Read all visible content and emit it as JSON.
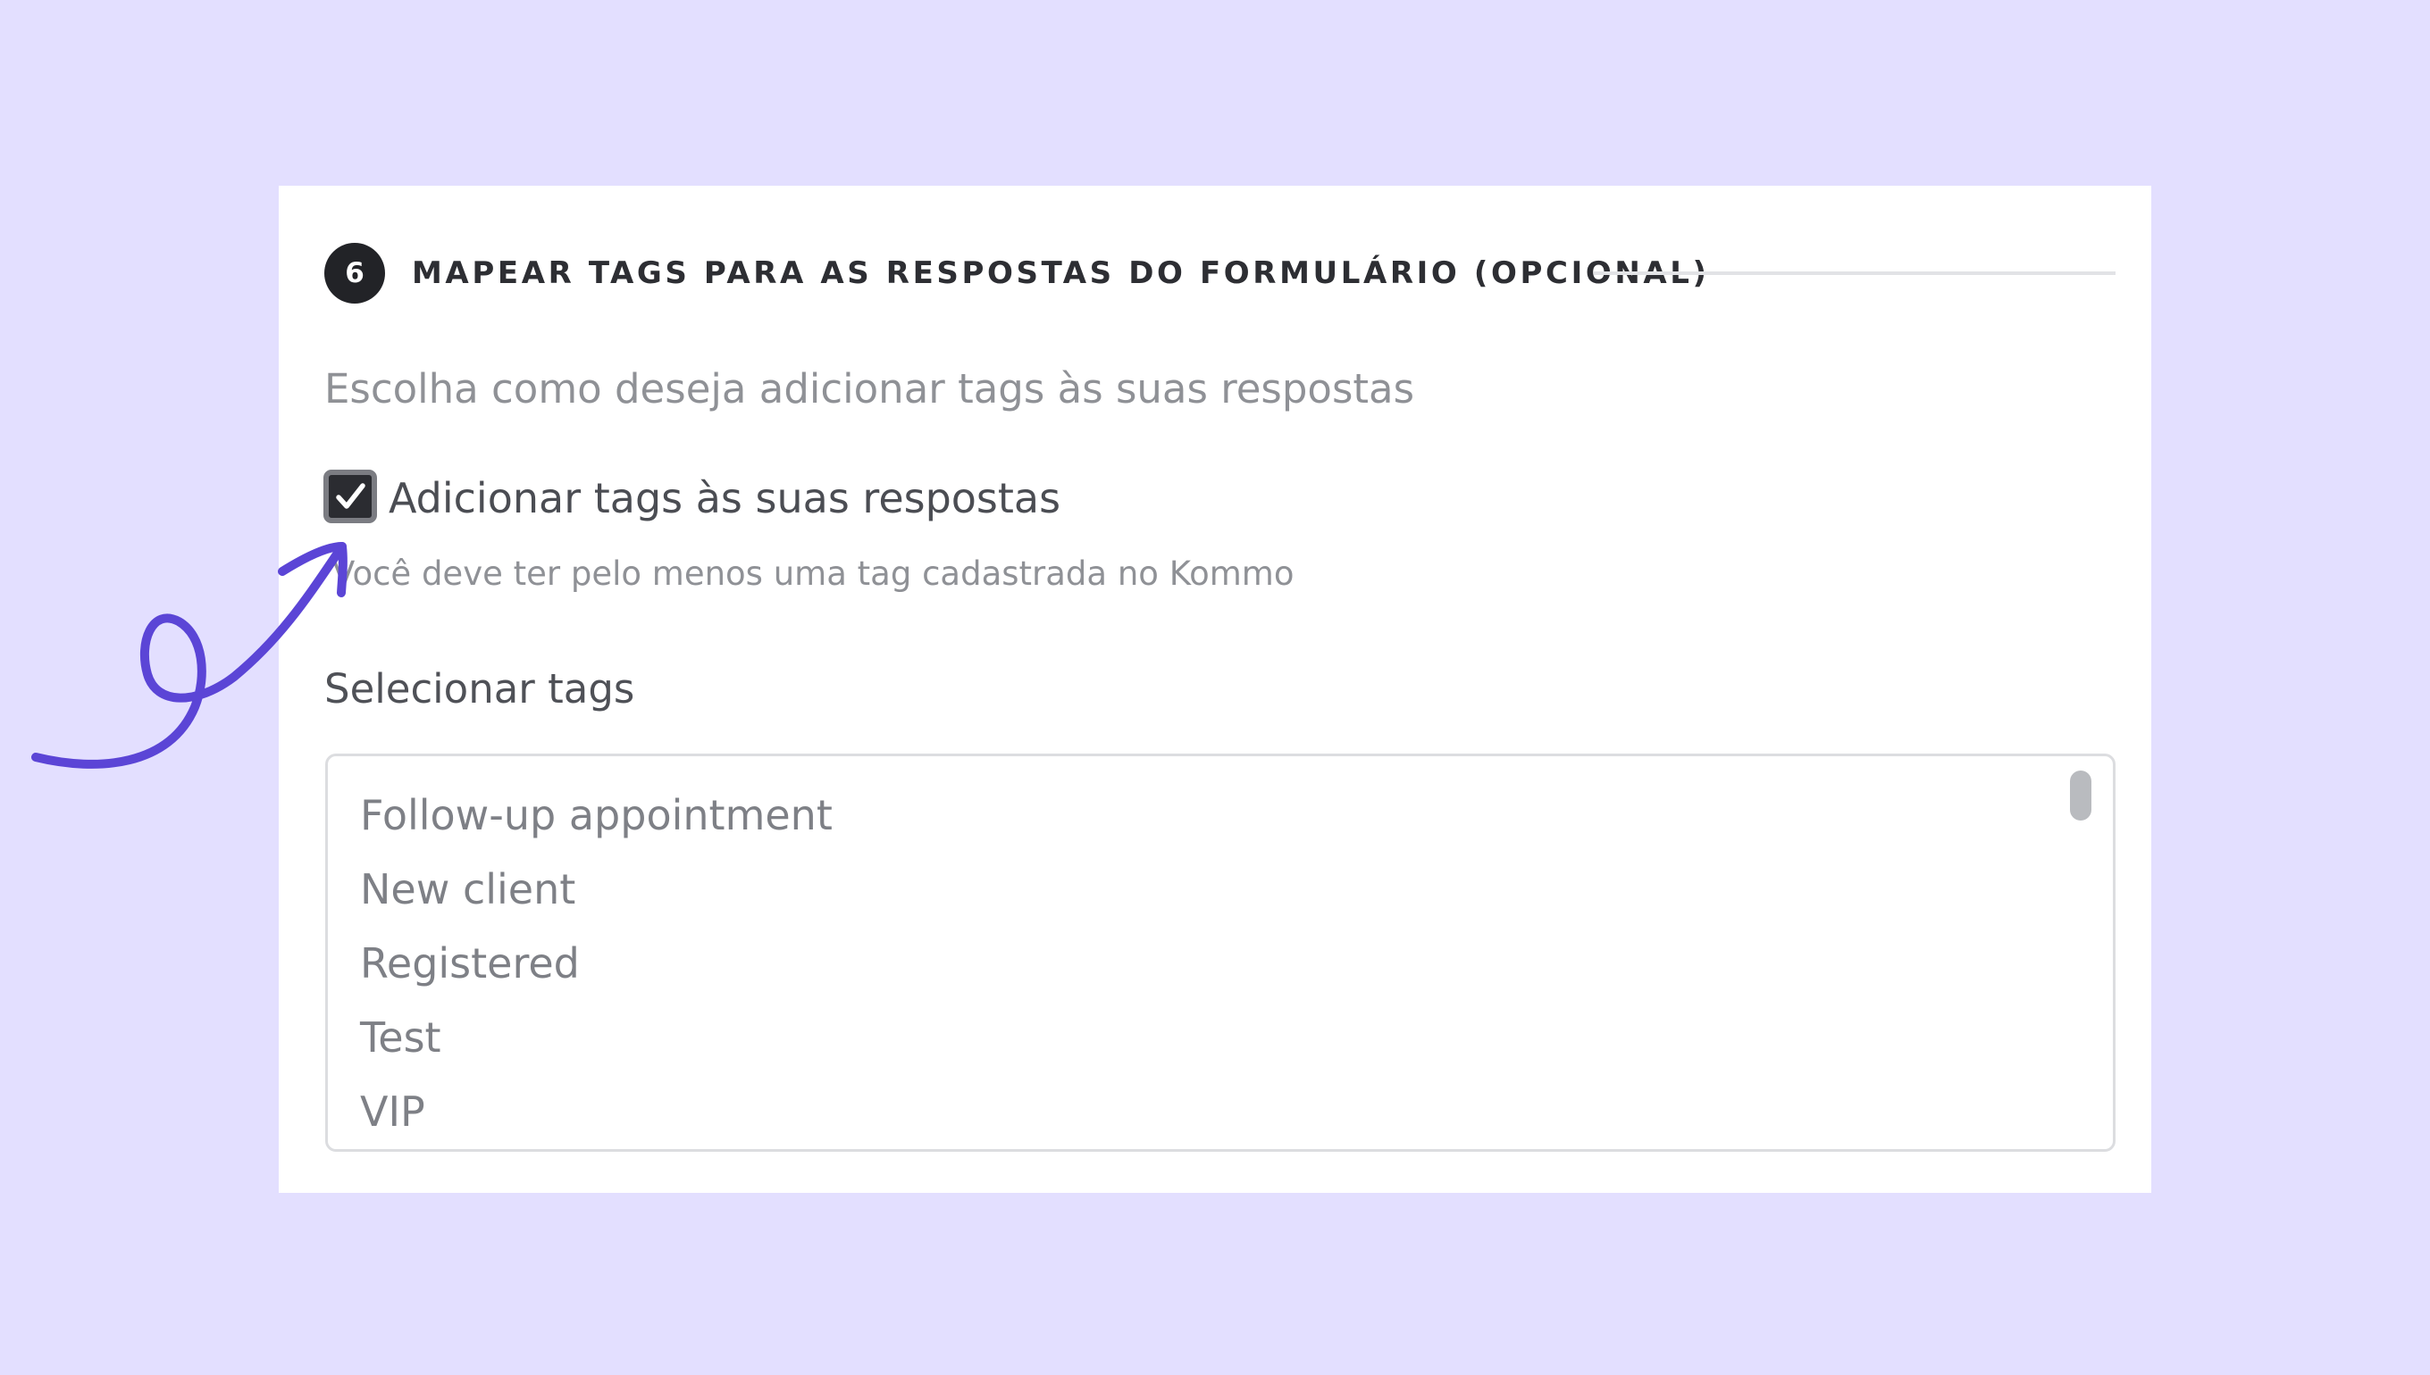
{
  "section": {
    "step_number": "6",
    "title": "MAPEAR TAGS PARA AS RESPOSTAS DO FORMULÁRIO (OPCIONAL)",
    "subtitle": "Escolha como deseja adicionar tags às suas respostas"
  },
  "add_tags_checkbox": {
    "checked": true,
    "label": "Adicionar tags às suas respostas",
    "hint": "Você deve ter pelo menos uma tag cadastrada no Kommo"
  },
  "tag_select": {
    "label": "Selecionar tags",
    "options": [
      "Follow-up appointment",
      "New client",
      "Registered",
      "Test",
      "VIP"
    ]
  },
  "colors": {
    "background": "#e3dfff",
    "annotation_arrow": "#5b45d6",
    "checkbox_fill": "#2b2c31"
  },
  "annotation": {
    "icon": "hand-drawn-arrow-icon"
  }
}
